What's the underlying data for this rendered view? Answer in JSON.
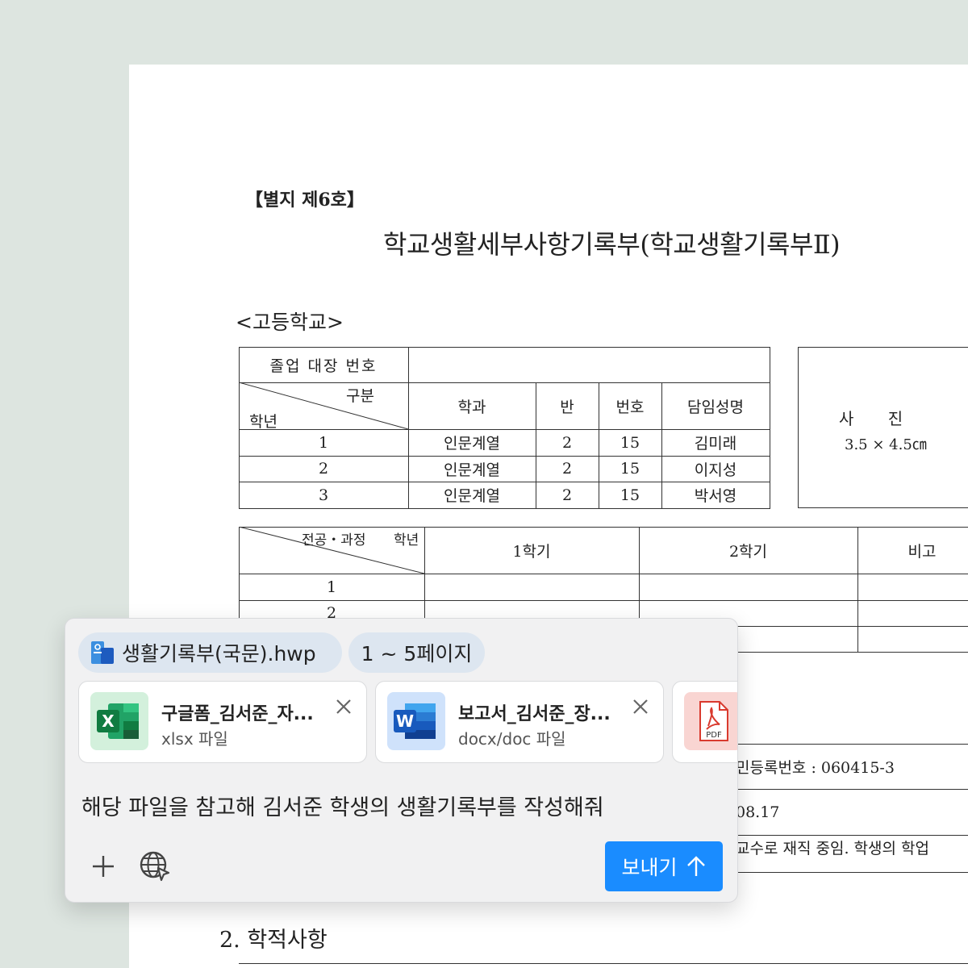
{
  "document": {
    "attachment_label": "【별지 제6호】",
    "title": "학교생활세부사항기록부(학교생활기록부Ⅱ)",
    "school_type": "<고등학교>",
    "table1": {
      "graduation_label": "졸업 대장 번호",
      "diag_top": "구분",
      "diag_bottom": "학년",
      "headers": [
        "학과",
        "반",
        "번호",
        "담임성명"
      ],
      "rows": [
        [
          "1",
          "인문계열",
          "2",
          "15",
          "김미래"
        ],
        [
          "2",
          "인문계열",
          "2",
          "15",
          "이지성"
        ],
        [
          "3",
          "인문계열",
          "2",
          "15",
          "박서영"
        ]
      ]
    },
    "photo": {
      "label": "사 진",
      "size": "3.5 × 4.5㎝"
    },
    "table2": {
      "diag_top": "전공・과정",
      "diag_right": "학년",
      "headers": [
        "1학기",
        "2학기",
        "비고"
      ],
      "rows": [
        "1",
        "2"
      ]
    },
    "registration_fragment": "민등록번호 : 060415-3",
    "date_fragment": "08.17",
    "teacher_fragment": "교수로 재직 중임. 학생의 학업",
    "section2": "2. 학적사항"
  },
  "panel": {
    "file_chip": {
      "name": "생활기록부(국문).hwp",
      "icon": "hwp-file-icon"
    },
    "pages_chip": "1 ~ 5페이지",
    "attachments": [
      {
        "title": "구글폼_김서준_자...",
        "type": "xlsx 파일",
        "icon": "excel-icon",
        "color": "#1f7a45"
      },
      {
        "title": "보고서_김서준_장...",
        "type": "docx/doc 파일",
        "icon": "word-icon",
        "color": "#1d5bbf"
      },
      {
        "title": "",
        "type": "",
        "icon": "pdf-icon",
        "color": "#d93a2e"
      }
    ],
    "excel_letter": "X",
    "word_letter": "W",
    "pdf_badge": "PDF",
    "prompt": "해당 파일을 참고해 김서준 학생의 생활기록부를 작성해줘",
    "send_label": "보내기",
    "accent": "#1a8cff"
  }
}
